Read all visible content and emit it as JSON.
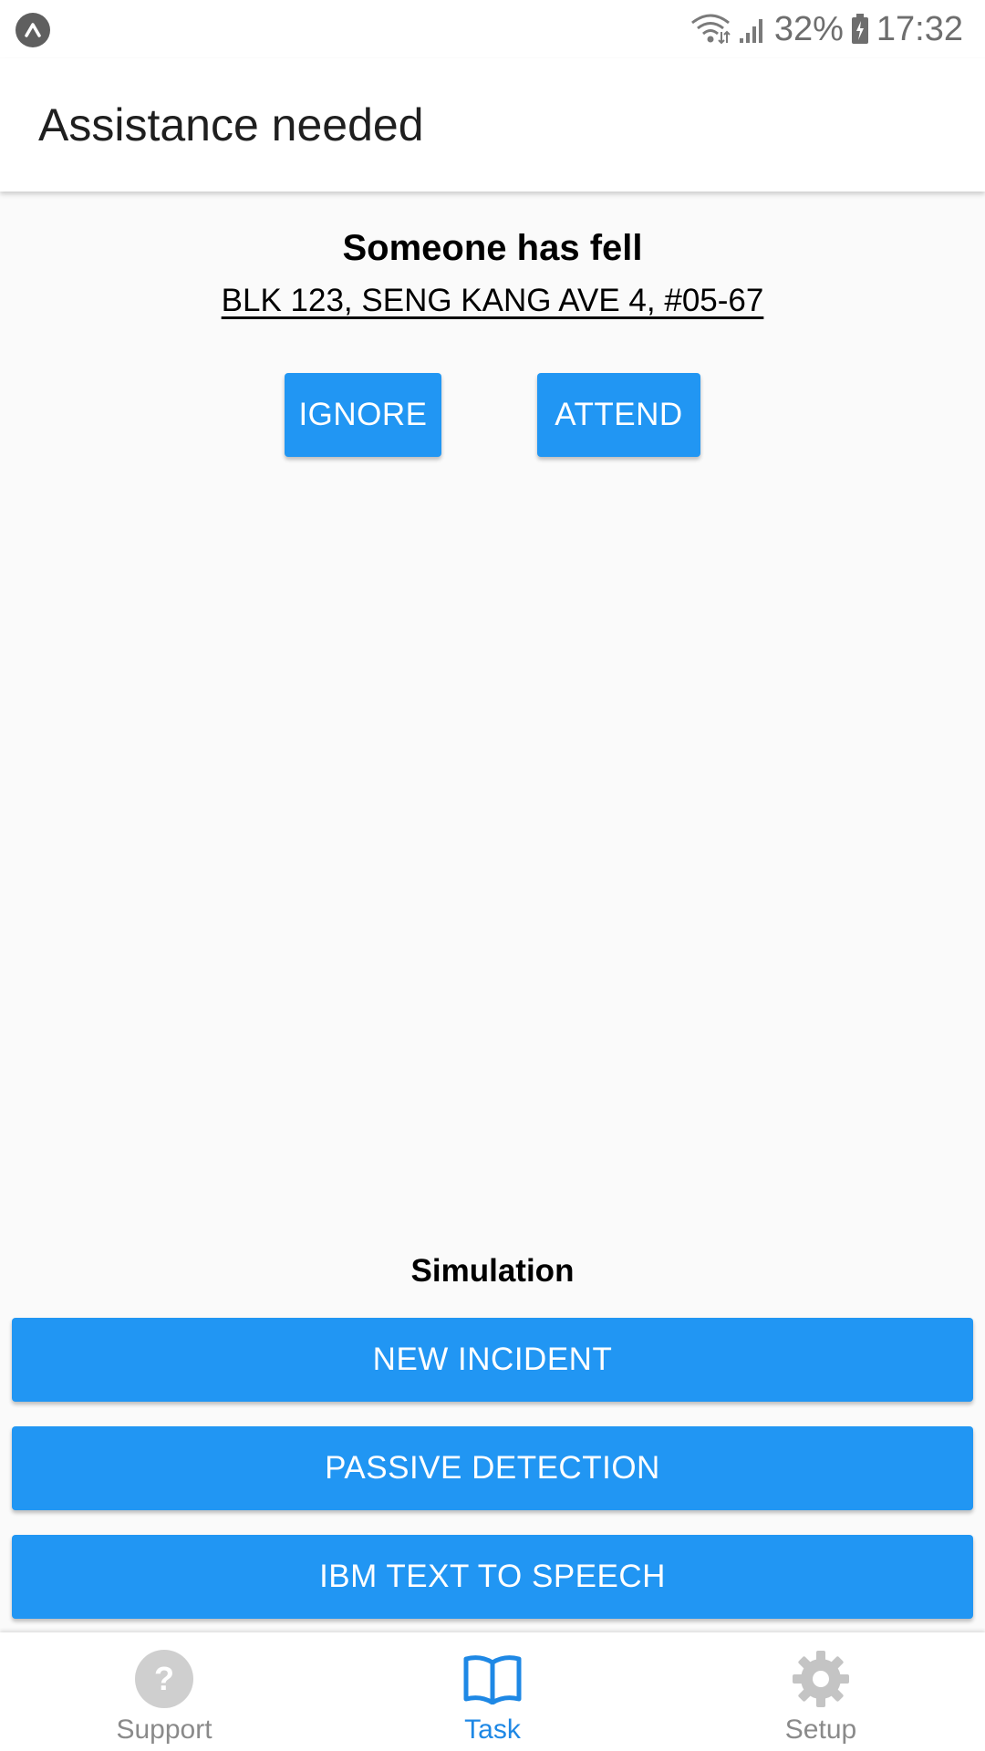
{
  "status_bar": {
    "battery": "32%",
    "time": "17:32",
    "icons": [
      "app-notification-icon",
      "wifi-icon",
      "signal-icon",
      "battery-charging-icon"
    ]
  },
  "app_bar": {
    "title": "Assistance needed"
  },
  "alert": {
    "title": "Someone has fell",
    "address": "BLK 123, SENG KANG AVE 4, #05-67",
    "ignore_label": "IGNORE",
    "attend_label": "ATTEND"
  },
  "simulation": {
    "title": "Simulation",
    "buttons": [
      "NEW INCIDENT",
      "PASSIVE DETECTION",
      "IBM TEXT TO SPEECH"
    ]
  },
  "bottom_nav": {
    "items": [
      {
        "label": "Support",
        "icon": "help-circle-icon",
        "active": false
      },
      {
        "label": "Task",
        "icon": "open-book-icon",
        "active": true
      },
      {
        "label": "Setup",
        "icon": "gear-icon",
        "active": false
      }
    ]
  },
  "colors": {
    "primary": "#2196f3",
    "active_nav": "#1e88e5",
    "inactive_nav": "#8a8a8a",
    "background": "#fafafa"
  }
}
